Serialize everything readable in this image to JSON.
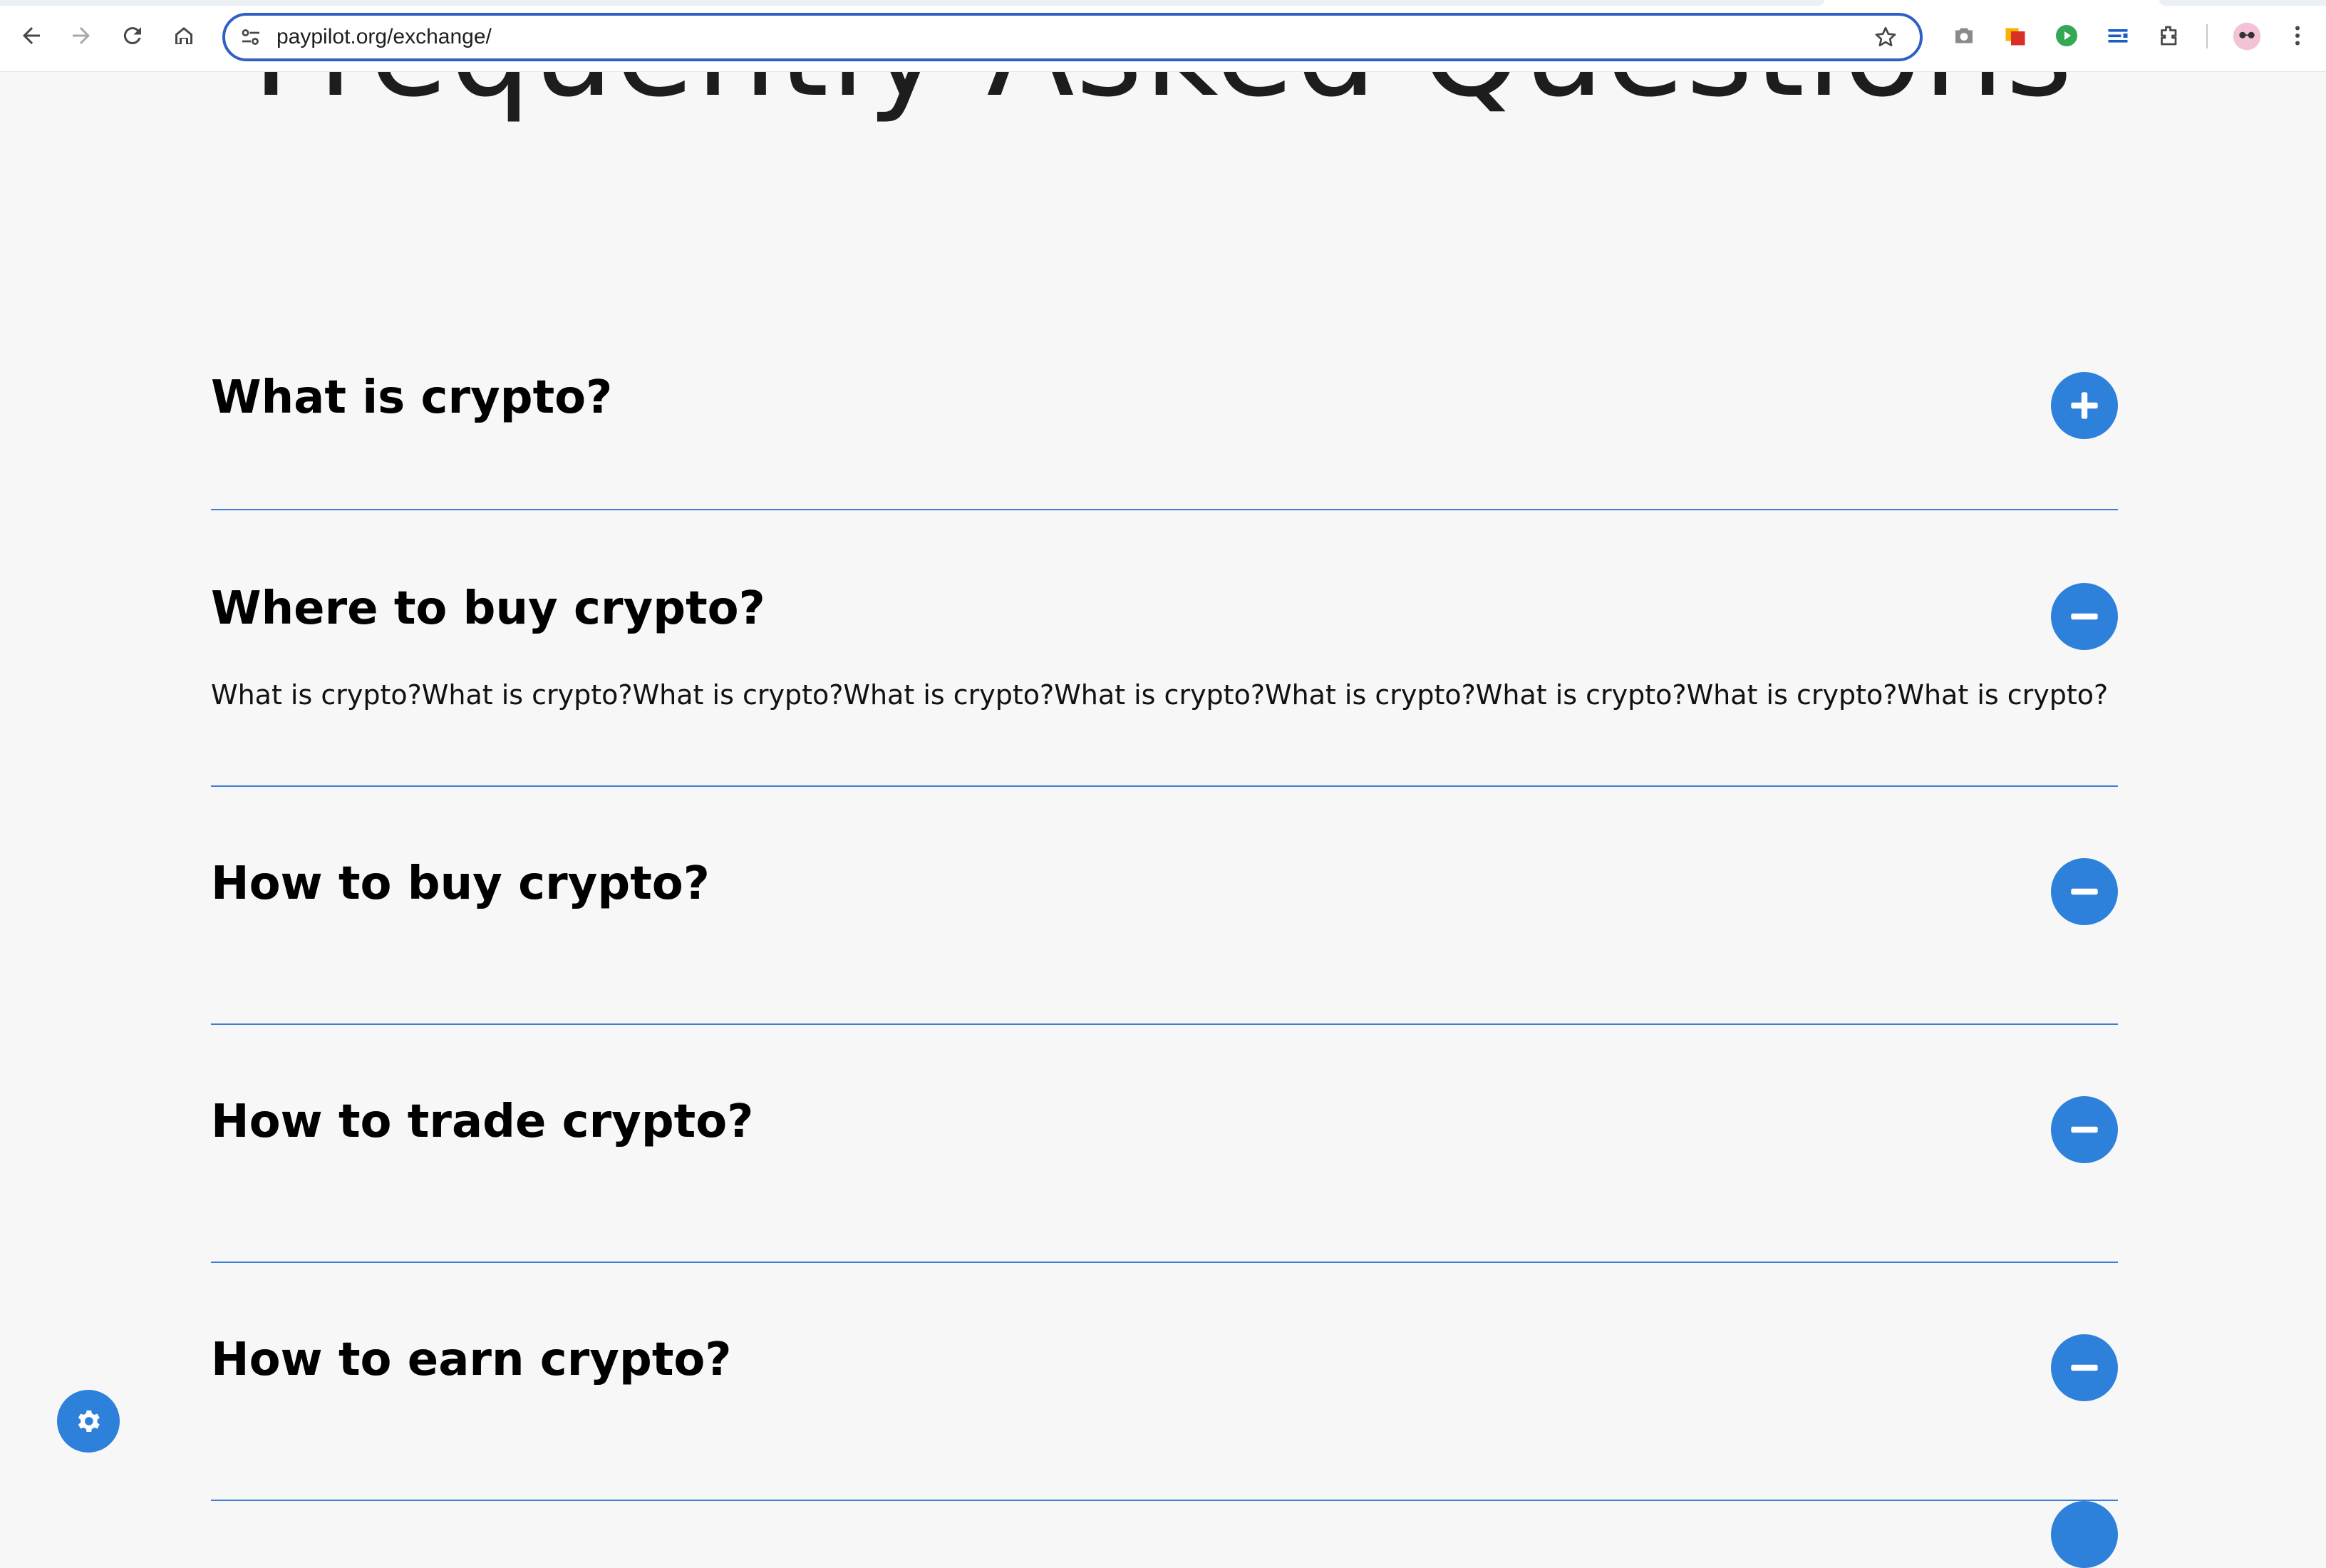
{
  "browser": {
    "url": "paypilot.org/exchange/",
    "icons": {
      "back": "arrow-left-icon",
      "forward": "arrow-right-icon",
      "reload": "reload-icon",
      "home": "home-icon",
      "site_info": "tune-icon",
      "bookmark": "star-icon",
      "extensions": [
        "camera-icon",
        "color-squares-icon",
        "play-circle-icon",
        "list-icon",
        "puzzle-icon"
      ],
      "profile": "avatar-icon",
      "menu": "kebab-menu-icon"
    }
  },
  "page": {
    "heading": "Frequently Asked Questions",
    "faq": [
      {
        "question": "What is crypto?",
        "answer": "",
        "state": "collapsed",
        "toggle_icon": "plus-icon"
      },
      {
        "question": "Where to buy crypto?",
        "answer": "What is crypto?What is crypto?What is crypto?What is crypto?What is crypto?What is crypto?What is crypto?What is crypto?What is crypto?",
        "state": "expanded",
        "toggle_icon": "minus-icon"
      },
      {
        "question": "How to buy crypto?",
        "answer": "",
        "state": "expanded",
        "toggle_icon": "minus-icon"
      },
      {
        "question": "How to trade crypto?",
        "answer": "",
        "state": "expanded",
        "toggle_icon": "minus-icon"
      },
      {
        "question": "How to earn crypto?",
        "answer": "",
        "state": "expanded",
        "toggle_icon": "minus-icon"
      }
    ],
    "settings_fab_icon": "gear-icon"
  },
  "colors": {
    "accent": "#2d81db",
    "divider": "#3c7ed6",
    "background": "#f7f7f7",
    "omnibox_focus": "#2f5fc4"
  }
}
